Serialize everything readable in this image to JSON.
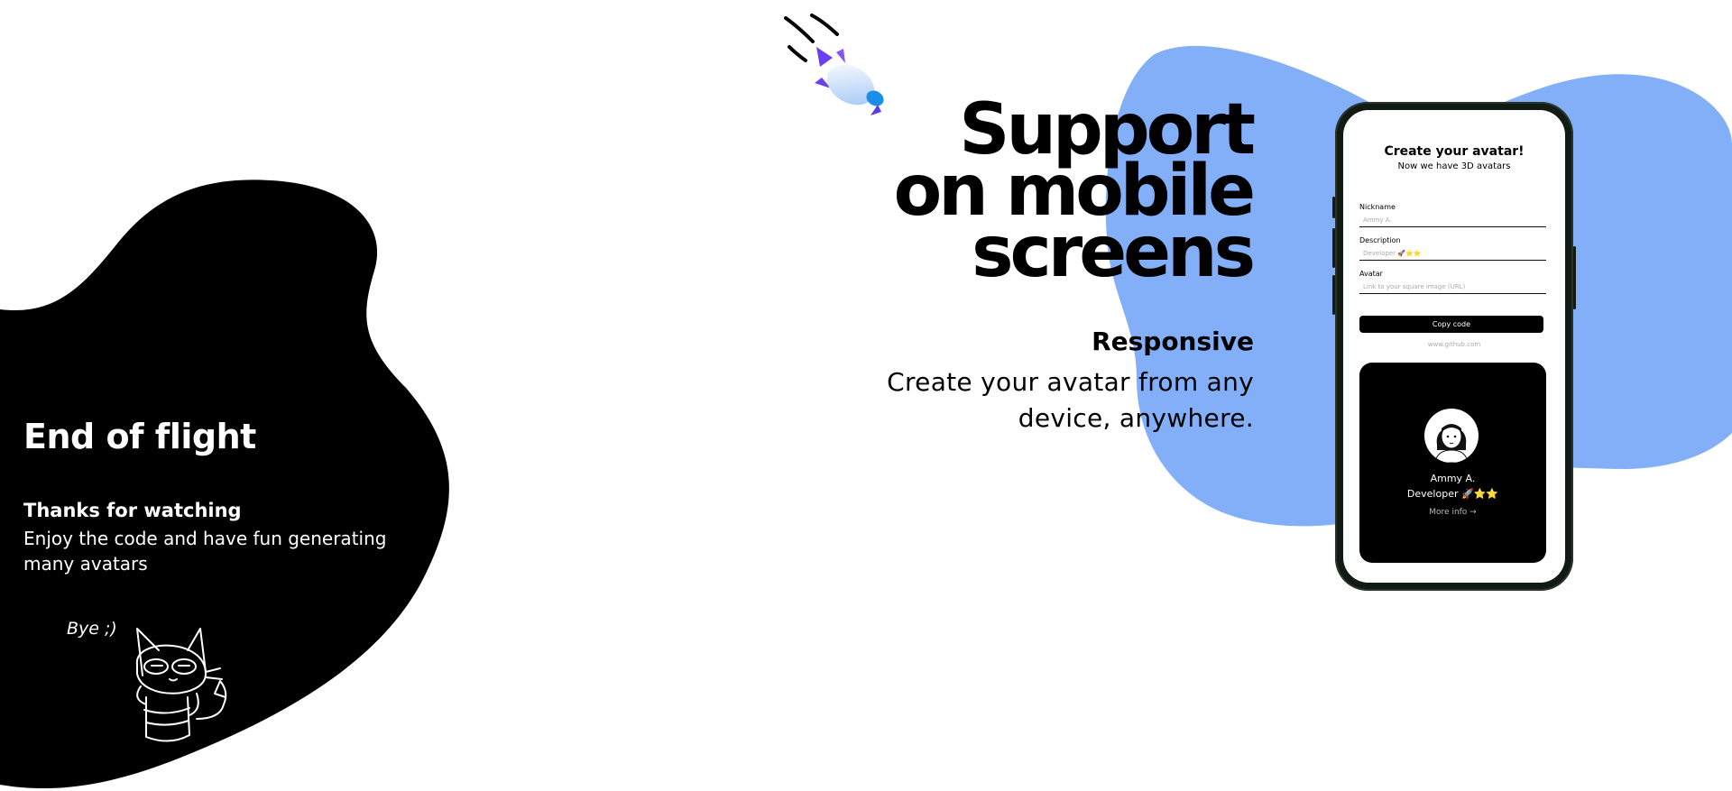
{
  "left_panel": {
    "title": "End of flight",
    "subtitle": "Thanks for watching",
    "text": "Enjoy the code and have fun generating many avatars",
    "doodle_text": "Bye ;)"
  },
  "headline": {
    "line1": "Support",
    "line2": "on mobile",
    "line3": "screens"
  },
  "responsive": {
    "title": "Responsive",
    "text": "Create your avatar from any device, anywhere."
  },
  "phone": {
    "form_title": "Create your avatar!",
    "form_subtitle": "Now we have 3D avatars",
    "fields": [
      {
        "label": "Nickname",
        "placeholder": "Ammy A."
      },
      {
        "label": "Description",
        "placeholder": "Developer 🚀⭐⭐"
      },
      {
        "label": "Avatar",
        "placeholder": "Link to your square image (URL)"
      }
    ],
    "copy_button": "Copy code",
    "link": "www.github.com",
    "card": {
      "name": "Ammy A.",
      "role": "Developer 🚀⭐⭐",
      "more": "More info →"
    }
  },
  "colors": {
    "blob_blue": "#82aff8",
    "blob_black": "#000000",
    "phone_frame": "#121a14"
  },
  "icons": [
    "rocket-icon",
    "cat-doodle",
    "arrow-right-icon",
    "avatar-illustration"
  ]
}
